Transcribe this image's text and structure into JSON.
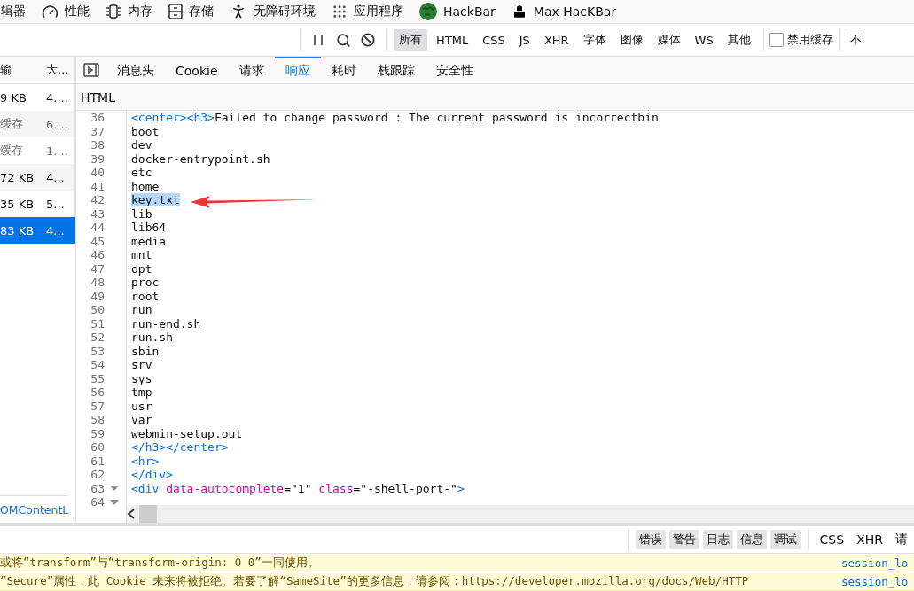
{
  "toolbox": [
    {
      "label": "辑器"
    },
    {
      "label": "性能"
    },
    {
      "label": "内存"
    },
    {
      "label": "存储"
    },
    {
      "label": "无障碍环境"
    },
    {
      "label": "应用程序"
    },
    {
      "label": "HackBar"
    },
    {
      "label": "Max HacKBar"
    }
  ],
  "filters": [
    {
      "label": "所有",
      "selected": true
    },
    {
      "label": "HTML",
      "selected": false
    },
    {
      "label": "CSS",
      "selected": false
    },
    {
      "label": "JS",
      "selected": false
    },
    {
      "label": "XHR",
      "selected": false
    },
    {
      "label": "字体",
      "selected": false
    },
    {
      "label": "图像",
      "selected": false
    },
    {
      "label": "媒体",
      "selected": false
    },
    {
      "label": "WS",
      "selected": false
    },
    {
      "label": "其他",
      "selected": false
    }
  ],
  "disable_cache": {
    "label": "禁用缓存",
    "checked": false
  },
  "throttle": "不",
  "requests": {
    "columns": [
      "输",
      "大..."
    ],
    "rows": [
      {
        "cells": [
          "9 KB",
          "4...."
        ],
        "cached": false,
        "selected": false
      },
      {
        "cells": [
          "缓存",
          "6...."
        ],
        "cached": true,
        "selected": false
      },
      {
        "cells": [
          "缓存",
          "1...."
        ],
        "cached": true,
        "selected": false
      },
      {
        "cells": [
          "72 KB",
          "4..."
        ],
        "cached": false,
        "selected": false
      },
      {
        "cells": [
          "35 KB",
          "5..."
        ],
        "cached": false,
        "selected": false
      },
      {
        "cells": [
          "83 KB",
          "4..."
        ],
        "cached": false,
        "selected": true
      }
    ],
    "summary": "OMContentL"
  },
  "tabs": [
    {
      "label": "消息头",
      "selected": false
    },
    {
      "label": "Cookie",
      "selected": false
    },
    {
      "label": "请求",
      "selected": false
    },
    {
      "label": "响应",
      "selected": true
    },
    {
      "label": "耗时",
      "selected": false
    },
    {
      "label": "栈跟踪",
      "selected": false
    },
    {
      "label": "安全性",
      "selected": false
    }
  ],
  "response": {
    "format": "HTML",
    "lines": [
      {
        "number": "36",
        "tokens": [
          {
            "kind": "tag",
            "text": "<center><h3>"
          },
          {
            "kind": "text",
            "text": "Failed to change password : The current password is incorrectbin"
          }
        ]
      },
      {
        "number": "37",
        "tokens": [
          {
            "kind": "text",
            "text": "boot"
          }
        ]
      },
      {
        "number": "38",
        "tokens": [
          {
            "kind": "text",
            "text": "dev"
          }
        ]
      },
      {
        "number": "39",
        "tokens": [
          {
            "kind": "text",
            "text": "docker-entrypoint.sh"
          }
        ]
      },
      {
        "number": "40",
        "tokens": [
          {
            "kind": "text",
            "text": "etc"
          }
        ]
      },
      {
        "number": "41",
        "tokens": [
          {
            "kind": "text",
            "text": "home"
          }
        ]
      },
      {
        "number": "42",
        "tokens": [
          {
            "kind": "text",
            "text": "key.txt"
          }
        ],
        "selected": true
      },
      {
        "number": "43",
        "tokens": [
          {
            "kind": "text",
            "text": "lib"
          }
        ]
      },
      {
        "number": "44",
        "tokens": [
          {
            "kind": "text",
            "text": "lib64"
          }
        ]
      },
      {
        "number": "45",
        "tokens": [
          {
            "kind": "text",
            "text": "media"
          }
        ]
      },
      {
        "number": "46",
        "tokens": [
          {
            "kind": "text",
            "text": "mnt"
          }
        ]
      },
      {
        "number": "47",
        "tokens": [
          {
            "kind": "text",
            "text": "opt"
          }
        ]
      },
      {
        "number": "48",
        "tokens": [
          {
            "kind": "text",
            "text": "proc"
          }
        ]
      },
      {
        "number": "49",
        "tokens": [
          {
            "kind": "text",
            "text": "root"
          }
        ]
      },
      {
        "number": "50",
        "tokens": [
          {
            "kind": "text",
            "text": "run"
          }
        ]
      },
      {
        "number": "51",
        "tokens": [
          {
            "kind": "text",
            "text": "run-end.sh"
          }
        ]
      },
      {
        "number": "52",
        "tokens": [
          {
            "kind": "text",
            "text": "run.sh"
          }
        ]
      },
      {
        "number": "53",
        "tokens": [
          {
            "kind": "text",
            "text": "sbin"
          }
        ]
      },
      {
        "number": "54",
        "tokens": [
          {
            "kind": "text",
            "text": "srv"
          }
        ]
      },
      {
        "number": "55",
        "tokens": [
          {
            "kind": "text",
            "text": "sys"
          }
        ]
      },
      {
        "number": "56",
        "tokens": [
          {
            "kind": "text",
            "text": "tmp"
          }
        ]
      },
      {
        "number": "57",
        "tokens": [
          {
            "kind": "text",
            "text": "usr"
          }
        ]
      },
      {
        "number": "58",
        "tokens": [
          {
            "kind": "text",
            "text": "var"
          }
        ]
      },
      {
        "number": "59",
        "tokens": [
          {
            "kind": "text",
            "text": "webmin-setup.out"
          }
        ]
      },
      {
        "number": "60",
        "tokens": [
          {
            "kind": "tag",
            "text": "</h3></center>"
          }
        ]
      },
      {
        "number": "61",
        "tokens": [
          {
            "kind": "tag",
            "text": "<hr>"
          }
        ]
      },
      {
        "number": "62",
        "tokens": [
          {
            "kind": "tag",
            "text": "</div>"
          }
        ]
      },
      {
        "number": "63",
        "foldable": true,
        "tokens": [
          {
            "kind": "tag",
            "text": "<div "
          },
          {
            "kind": "attr",
            "text": "data-autocomplete"
          },
          {
            "kind": "text",
            "text": "=\"1\" "
          },
          {
            "kind": "attr",
            "text": "class"
          },
          {
            "kind": "text",
            "text": "=\"-shell-port-\""
          },
          {
            "kind": "tag",
            "text": ">"
          }
        ]
      },
      {
        "number": "64",
        "foldable": true
      }
    ]
  },
  "console_filters": [
    {
      "label": "错误",
      "selected": true
    },
    {
      "label": "警告",
      "selected": true
    },
    {
      "label": "日志",
      "selected": true
    },
    {
      "label": "信息",
      "selected": true
    },
    {
      "label": "调试",
      "selected": true
    }
  ],
  "console_categories": [
    "CSS",
    "XHR",
    "请"
  ],
  "messages": [
    {
      "text": "或将“transform”与“transform-origin: 0 0”一同使用。",
      "source": "session_lo"
    },
    {
      "text": "“Secure”属性，此 Cookie 未来将被拒绝。若要了解“SameSite”的更多信息，请参阅：https://developer.mozilla.org/docs/Web/HTTP",
      "source": "session_lo"
    }
  ]
}
